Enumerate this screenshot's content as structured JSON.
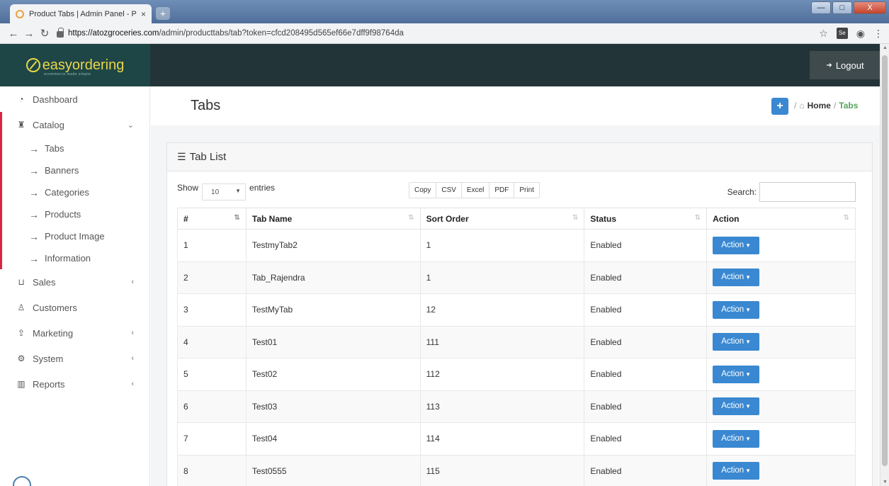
{
  "browser": {
    "tab_title": "Product Tabs | Admin Panel - Po",
    "tab_close": "×",
    "new_tab": "+",
    "url_host": "https://atozgroceries.com",
    "url_path": "/admin/producttabs/tab?token=cfcd208495d565ef66e7dff9f98764da",
    "minimize": "—",
    "maximize": "□",
    "close": "X"
  },
  "header": {
    "logo_text": "easyordering",
    "tagline": "ecommerce made simple",
    "logout_label": "Logout"
  },
  "sidebar": {
    "dashboard": "Dashboard",
    "catalog": "Catalog",
    "catalog_items": [
      "Tabs",
      "Banners",
      "Categories",
      "Products",
      "Product Image",
      "Information"
    ],
    "sales": "Sales",
    "customers": "Customers",
    "marketing": "Marketing",
    "system": "System",
    "reports": "Reports"
  },
  "page": {
    "title": "Tabs",
    "add_label": "+",
    "breadcrumb_home": "Home",
    "breadcrumb_current": "Tabs"
  },
  "card": {
    "title": "Tab List",
    "show_label": "Show",
    "page_size": "10",
    "entries_label": "entries",
    "export_buttons": [
      "Copy",
      "CSV",
      "Excel",
      "PDF",
      "Print"
    ],
    "search_label": "Search:",
    "search_value": ""
  },
  "table": {
    "headers": [
      "#",
      "Tab Name",
      "Sort Order",
      "Status",
      "Action"
    ],
    "action_label": "Action",
    "rows": [
      {
        "num": "1",
        "name": "TestmyTab2",
        "sort": "1",
        "status": "Enabled"
      },
      {
        "num": "2",
        "name": "Tab_Rajendra",
        "sort": "1",
        "status": "Enabled"
      },
      {
        "num": "3",
        "name": "TestMyTab",
        "sort": "12",
        "status": "Enabled"
      },
      {
        "num": "4",
        "name": "Test01",
        "sort": "111",
        "status": "Enabled"
      },
      {
        "num": "5",
        "name": "Test02",
        "sort": "112",
        "status": "Enabled"
      },
      {
        "num": "6",
        "name": "Test03",
        "sort": "113",
        "status": "Enabled"
      },
      {
        "num": "7",
        "name": "Test04",
        "sort": "114",
        "status": "Enabled"
      },
      {
        "num": "8",
        "name": "Test0555",
        "sort": "115",
        "status": "Enabled"
      }
    ]
  },
  "colors": {
    "header_bg": "#233438",
    "logo_bg": "#1f4646",
    "logo_color": "#e9d64a",
    "primary": "#3a88d1",
    "catalog_accent": "#d9263e",
    "breadcrumb_active": "#57a35c"
  }
}
